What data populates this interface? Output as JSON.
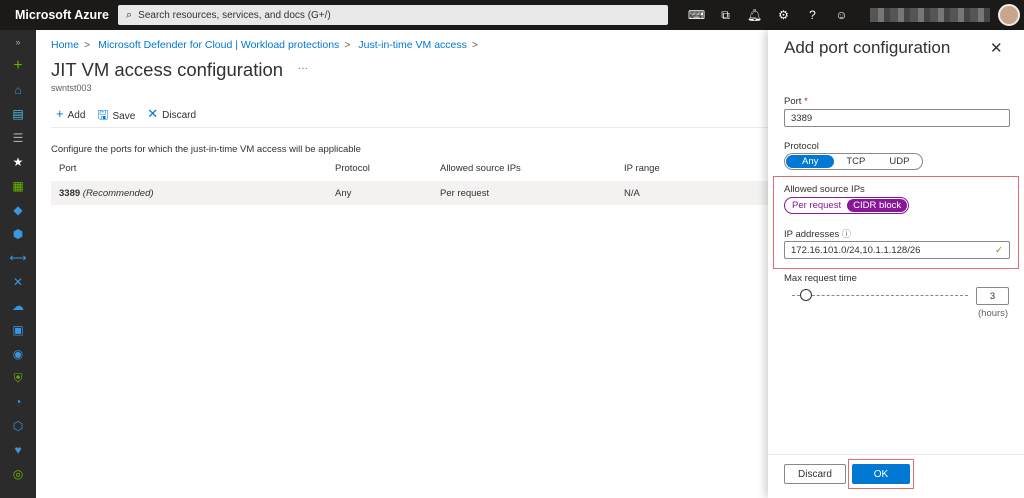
{
  "topbar": {
    "brand": "Microsoft Azure",
    "search_placeholder": "Search resources, services, and docs (G+/)"
  },
  "breadcrumb": [
    "Home",
    "Microsoft Defender for Cloud | Workload protections",
    "Just-in-time VM access"
  ],
  "page": {
    "title": "JIT VM access configuration",
    "more": "···",
    "subtitle": "swntst003"
  },
  "toolbar": {
    "add": "Add",
    "save": "Save",
    "discard": "Discard"
  },
  "description": "Configure the ports for which the just-in-time VM access will be applicable",
  "table": {
    "headers": [
      "Port",
      "Protocol",
      "Allowed source IPs",
      "IP range"
    ],
    "rows": [
      {
        "port": "3389",
        "note": "(Recommended)",
        "protocol": "Any",
        "source": "Per request",
        "range": "N/A"
      }
    ]
  },
  "panel": {
    "title": "Add port configuration",
    "port_label": "Port",
    "required": "*",
    "port_value": "3389",
    "protocol_label": "Protocol",
    "protocol_options": [
      "Any",
      "TCP",
      "UDP"
    ],
    "protocol_selected": "Any",
    "source_label": "Allowed source IPs",
    "source_options": [
      "Per request",
      "CIDR block"
    ],
    "source_selected": "CIDR block",
    "ip_label": "IP addresses",
    "ip_value": "172.16.101.0/24,10.1.1.128/26",
    "max_label": "Max request time",
    "max_value": "3",
    "max_unit": "(hours)",
    "discard": "Discard",
    "ok": "OK"
  },
  "colors": {
    "accent": "#0078d4",
    "purple": "#881798",
    "highlight": "#e06c6c"
  }
}
